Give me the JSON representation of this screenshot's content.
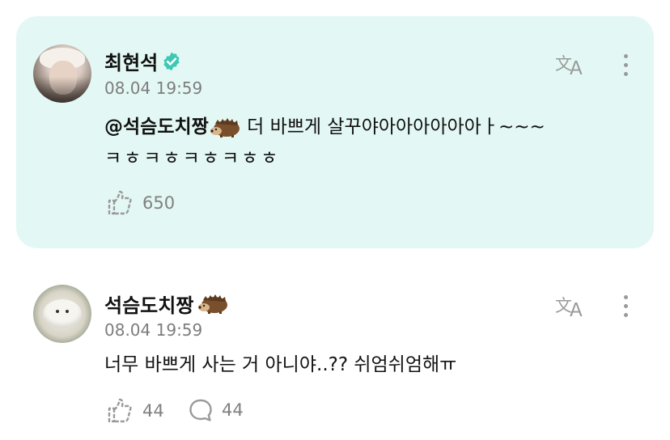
{
  "post": {
    "author_name": "최현석",
    "timestamp": "08.04 19:59",
    "mention": "@석슴도치짱",
    "text_after_mention": " 더 바쁘게 살꾸야아아아아아아ㅏ~~~",
    "text_line2": "ㅋㅎㅋㅎㅋㅎㅋㅎㅎ",
    "likes_count": "650"
  },
  "reply": {
    "author_name": "석슴도치짱",
    "timestamp": "08.04 19:59",
    "text": "너무 바쁘게 사는 거 아니야..?? 쉬엄쉬엄해ㅠ",
    "likes_count": "44",
    "comments_count": "44"
  },
  "colors": {
    "highlight_bg": "#e3f8f4",
    "verified_badge": "#3cc8b4",
    "meta_gray": "#7d7d7d"
  },
  "icons": [
    "verified-badge-icon",
    "hedgehog-emoji-icon",
    "translate-icon",
    "more-options-icon",
    "like-icon",
    "comment-icon"
  ]
}
